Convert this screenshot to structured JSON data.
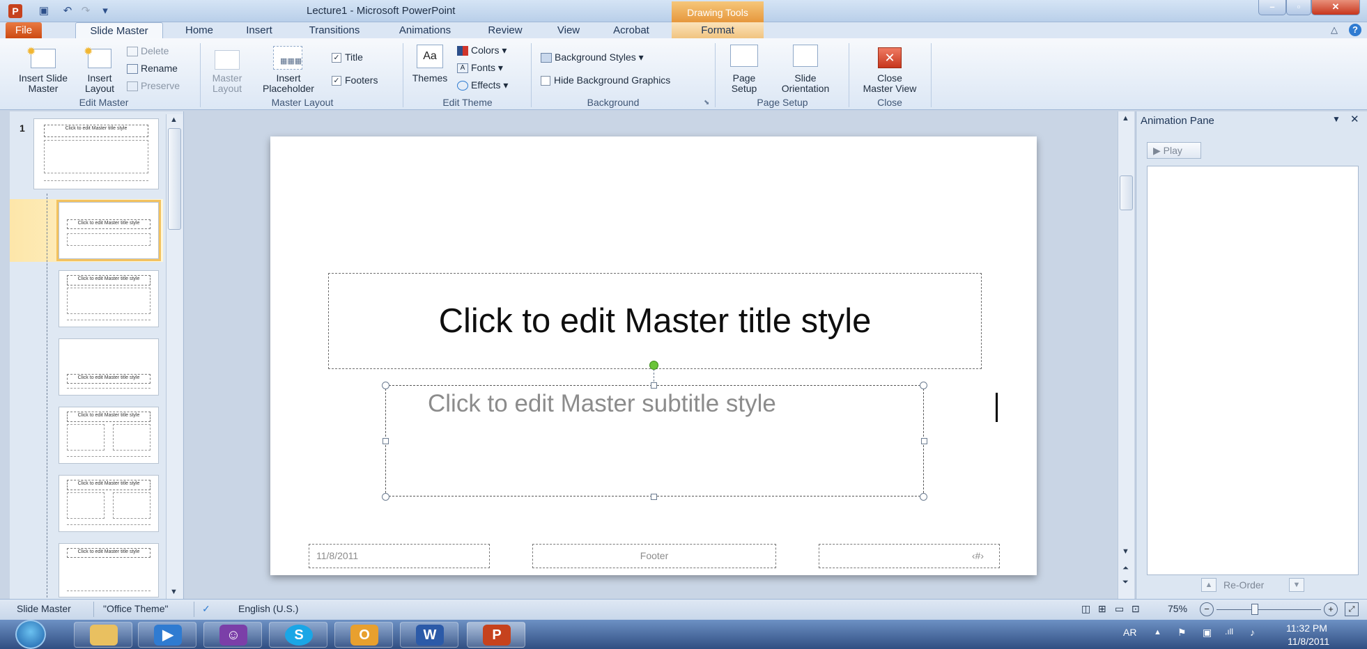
{
  "window": {
    "title": "Lecture1  -  Microsoft PowerPoint",
    "contextual_tab": "Drawing Tools"
  },
  "tabs": [
    "File",
    "Slide Master",
    "Home",
    "Insert",
    "Transitions",
    "Animations",
    "Review",
    "View",
    "Acrobat",
    "Format"
  ],
  "ribbon": {
    "edit_master": {
      "label": "Edit Master",
      "insert_slide_master": [
        "Insert Slide",
        "Master"
      ],
      "insert_layout": [
        "Insert",
        "Layout"
      ],
      "delete": "Delete",
      "rename": "Rename",
      "preserve": "Preserve"
    },
    "master_layout": {
      "label": "Master Layout",
      "master_layout_btn": [
        "Master",
        "Layout"
      ],
      "insert_placeholder": [
        "Insert",
        "Placeholder"
      ],
      "title_check": "Title",
      "footers_check": "Footers"
    },
    "edit_theme": {
      "label": "Edit Theme",
      "themes": "Themes",
      "colors": "Colors",
      "fonts": "Fonts",
      "effects": "Effects"
    },
    "background": {
      "label": "Background",
      "styles": "Background Styles",
      "hide_graphics": "Hide Background Graphics"
    },
    "page_setup": {
      "label": "Page Setup",
      "page_setup_btn": [
        "Page",
        "Setup"
      ],
      "orientation": [
        "Slide",
        "Orientation"
      ]
    },
    "close": {
      "label": "Close",
      "close_btn": [
        "Close",
        "Master View"
      ]
    }
  },
  "thumbnails": {
    "slide_number": "1",
    "master_title": "Click to edit Master title style",
    "small_title": "Click to edit Master title style"
  },
  "slide": {
    "title": "Click to edit Master title style",
    "subtitle": "Click to edit Master subtitle style",
    "footer_date": "11/8/2011",
    "footer_center": "Footer",
    "footer_number": "‹#›"
  },
  "animation_pane": {
    "title": "Animation Pane",
    "play": "Play",
    "reorder": "Re-Order"
  },
  "status_bar": {
    "view": "Slide Master",
    "theme": "\"Office Theme\"",
    "language": "English (U.S.)",
    "zoom": "75%"
  },
  "taskbar": {
    "lang": "AR",
    "time": "11:32 PM",
    "date": "11/8/2011"
  },
  "colors": {
    "file_tab": "#cc4a12",
    "drawing_tools": "#e6973c",
    "selection": "#f3c25f",
    "rotate_handle": "#6bc43a"
  }
}
